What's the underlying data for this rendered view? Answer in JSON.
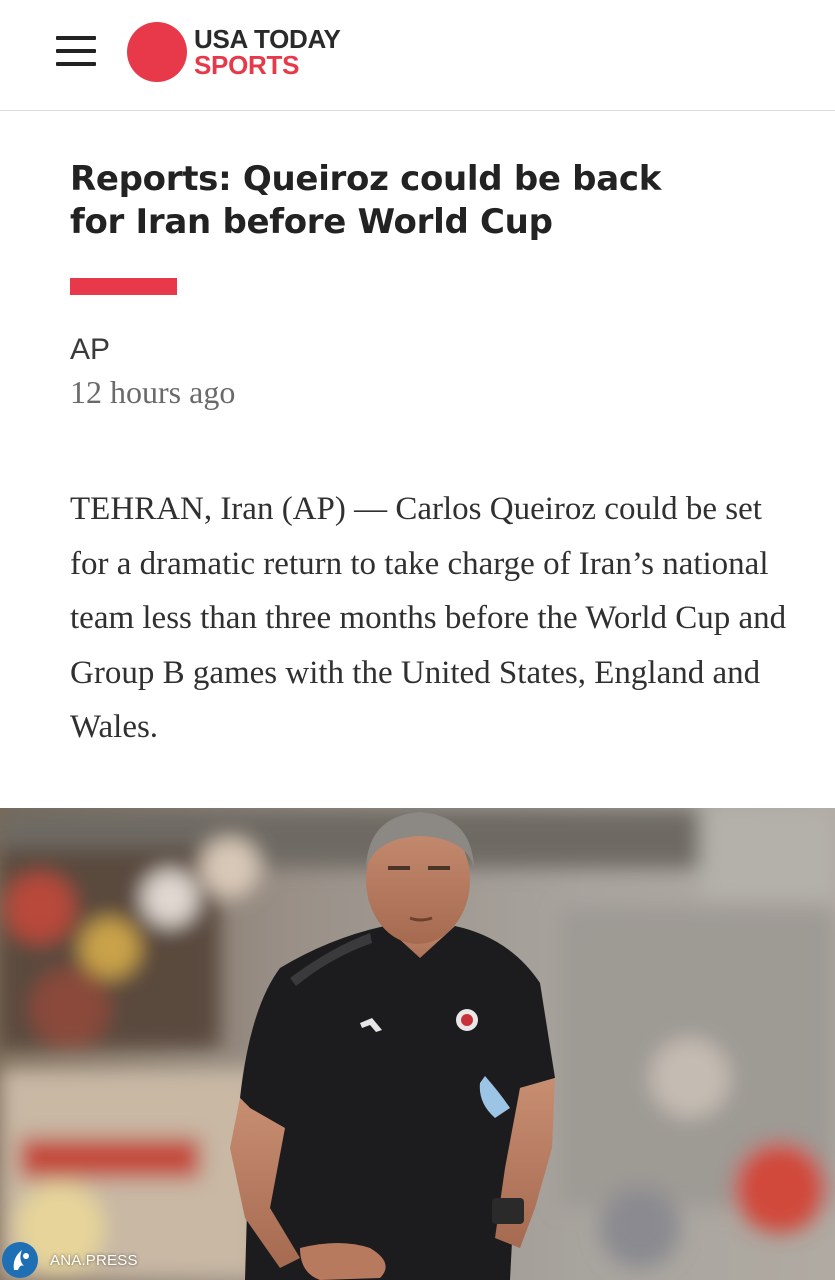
{
  "header": {
    "brand_line1": "USA TODAY",
    "brand_line2": "SPORTS",
    "menu_icon": "hamburger-menu-icon",
    "brand_color": "#e8394a"
  },
  "article": {
    "headline": "Reports: Queiroz could be back for Iran before World Cup",
    "byline": "AP",
    "timestamp": "12 hours ago",
    "body": "TEHRAN, Iran (AP) — Carlos Queiroz could be set for a dramatic return to take charge of Iran’s national team less than three months before the World Cup and Group B games with the United States, England and Wales."
  },
  "watermark": {
    "label": "ANA.PRESS"
  }
}
